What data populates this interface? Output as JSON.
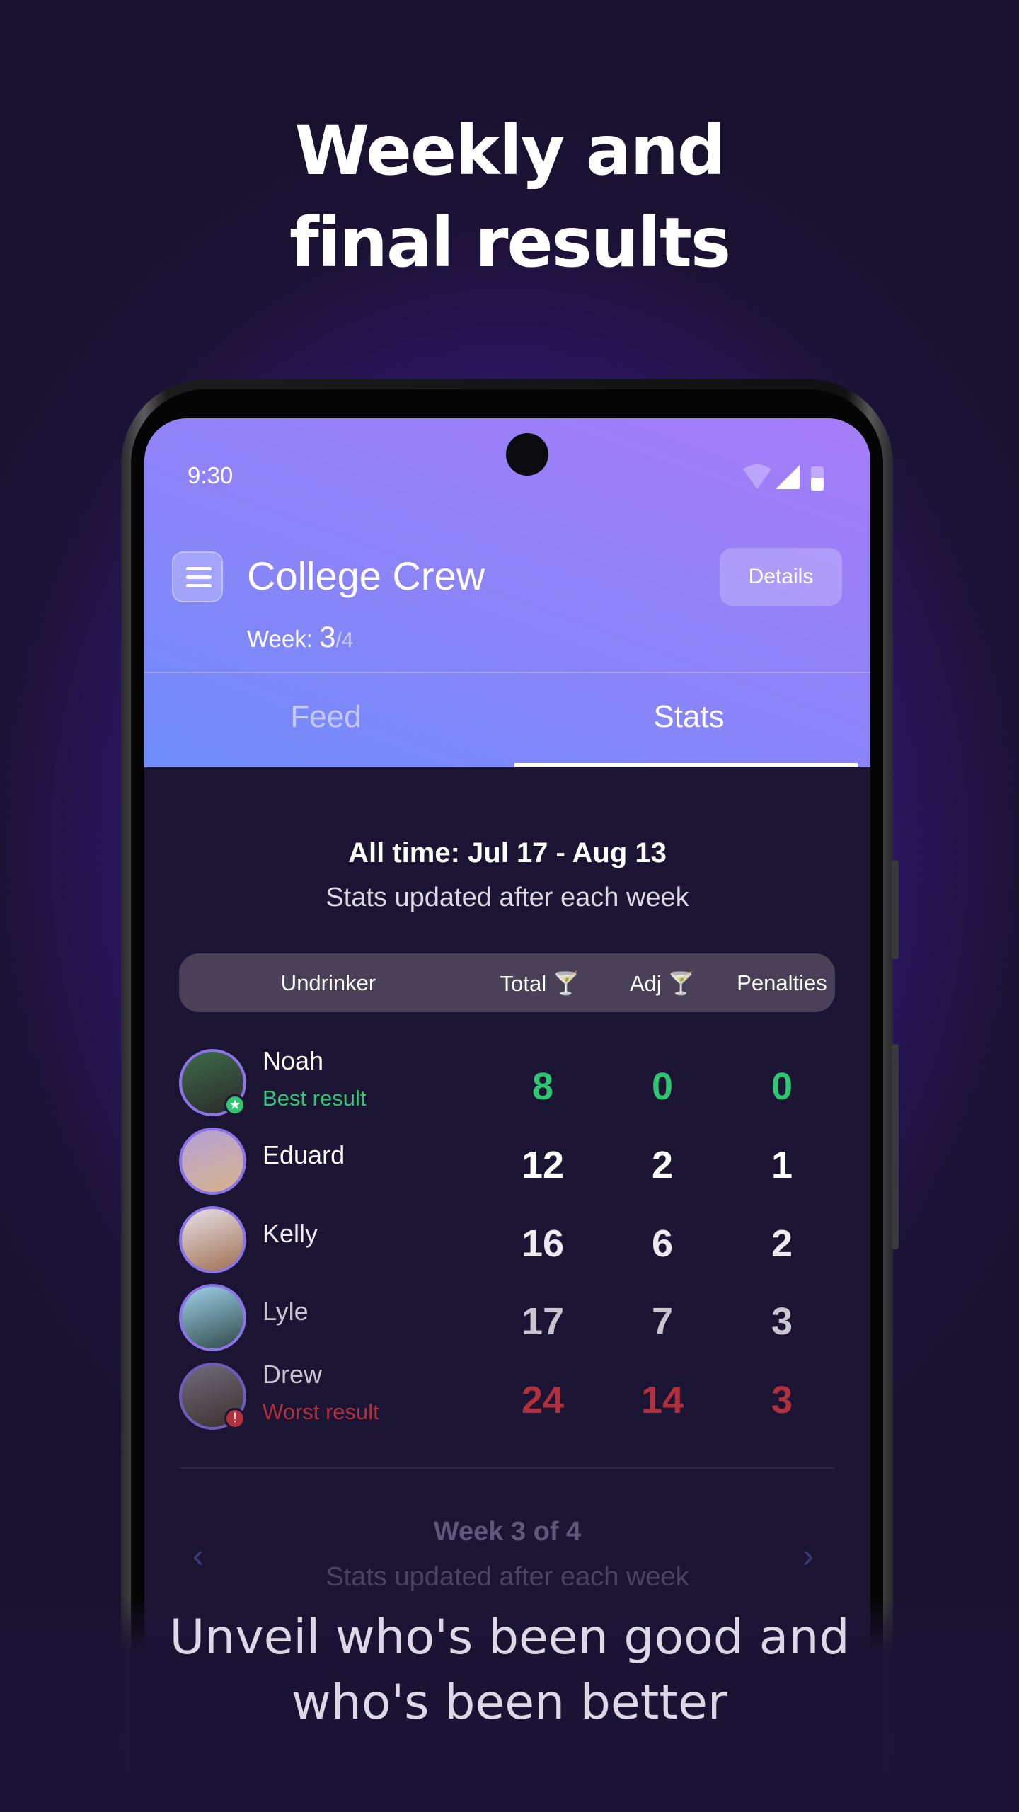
{
  "promo": {
    "headline_line1": "Weekly and",
    "headline_line2": "final results",
    "caption_line1": "Unveil who's been good and",
    "caption_line2": "who's been better"
  },
  "status_bar": {
    "time": "9:30",
    "icons": [
      "wifi-icon",
      "signal-icon",
      "battery-icon"
    ]
  },
  "header": {
    "title": "College Crew",
    "week_label": "Week:",
    "week_current": "3",
    "week_total": "/4",
    "details_label": "Details",
    "menu_icon": "hamburger-menu-icon"
  },
  "tabs": [
    {
      "label": "Feed",
      "active": false
    },
    {
      "label": "Stats",
      "active": true
    }
  ],
  "stats": {
    "period_title": "All time: Jul 17 - Aug 13",
    "period_subtitle": "Stats updated after each week",
    "columns": {
      "name": "Undrinker",
      "total": "Total",
      "adj": "Adj",
      "penalties": "Penalties",
      "drink_icon": "🍸"
    },
    "rows": [
      {
        "name": "Noah",
        "note": "Best result",
        "total": "8",
        "adj": "0",
        "penalties": "0",
        "status": "best"
      },
      {
        "name": "Eduard",
        "note": "",
        "total": "12",
        "adj": "2",
        "penalties": "1",
        "status": "normal"
      },
      {
        "name": "Kelly",
        "note": "",
        "total": "16",
        "adj": "6",
        "penalties": "2",
        "status": "normal"
      },
      {
        "name": "Lyle",
        "note": "",
        "total": "17",
        "adj": "7",
        "penalties": "3",
        "status": "normal"
      },
      {
        "name": "Drew",
        "note": "Worst result",
        "total": "24",
        "adj": "14",
        "penalties": "3",
        "status": "worst"
      }
    ],
    "week_nav": {
      "title": "Week 3 of 4",
      "subtitle": "Stats updated after each week"
    }
  },
  "colors": {
    "best": "#2ec771",
    "worst": "#b0303c",
    "accent": "#8b84f8",
    "background": "#1c1433"
  }
}
